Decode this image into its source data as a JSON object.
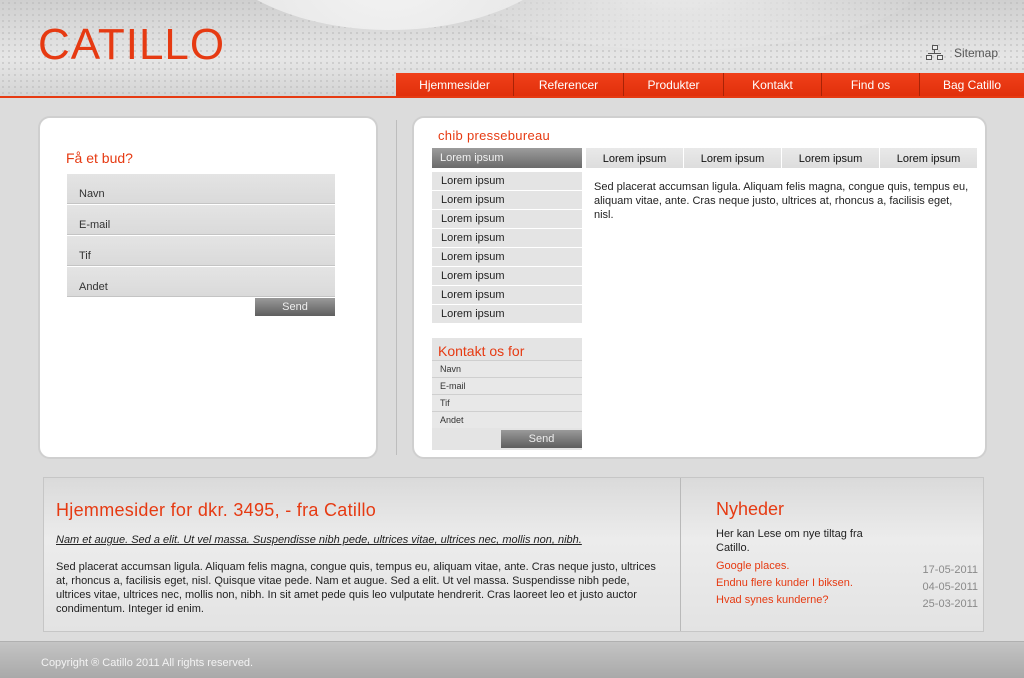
{
  "brand": {
    "logo_text": "CATILLO",
    "accent_color": "#e63a12"
  },
  "header": {
    "sitemap_label": "Sitemap",
    "sitemap_icon": "sitemap-icon",
    "nav": [
      {
        "label": "Hjemmesider"
      },
      {
        "label": "Referencer"
      },
      {
        "label": "Produkter"
      },
      {
        "label": "Kontakt"
      },
      {
        "label": "Find os"
      },
      {
        "label": "Bag Catillo"
      }
    ]
  },
  "quote_form": {
    "title": "Få et bud?",
    "fields": [
      "Navn",
      "E-mail",
      "Tif",
      "Andet"
    ],
    "send_label": "Send"
  },
  "press": {
    "title": "chib pressebureau",
    "active_item": "Lorem ipsum",
    "items": [
      "Lorem ipsum",
      "Lorem ipsum",
      "Lorem ipsum",
      "Lorem ipsum",
      "Lorem ipsum",
      "Lorem ipsum",
      "Lorem ipsum",
      "Lorem ipsum"
    ],
    "tabs": [
      "Lorem ipsum",
      "Lorem ipsum",
      "Lorem ipsum",
      "Lorem ipsum"
    ],
    "tab_text": "Sed placerat accumsan ligula. Aliquam felis magna, congue quis, tempus eu, aliquam vitae, ante. Cras neque justo, ultrices at, rhoncus a, facilisis eget, nisl."
  },
  "contact_form": {
    "title": "Kontakt os for",
    "fields": [
      "Navn",
      "E-mail",
      "Tif",
      "Andet"
    ],
    "send_label": "Send"
  },
  "promo": {
    "title": "Hjemmesider for dkr. 3495, - fra Catillo",
    "lead": "Nam et augue. Sed a elit. Ut vel massa. Suspendisse nibh pede, ultrices vitae, ultrices nec, mollis non, nibh.",
    "body": "Sed placerat accumsan ligula. Aliquam felis magna, congue quis, tempus eu, aliquam vitae, ante. Cras neque justo, ultrices at, rhoncus a, facilisis eget, nisl. Quisque vitae pede. Nam et augue. Sed a elit. Ut vel massa. Suspendisse nibh pede, ultrices vitae, ultrices nec, mollis non, nibh. In sit amet pede quis leo vulputate hendrerit. Cras laoreet leo et justo auctor condimentum. Integer id enim."
  },
  "news": {
    "title": "Nyheder",
    "intro": "Her kan Lese om nye tiltag fra Catillo.",
    "items": [
      {
        "title": "Google places.",
        "date": "17-05-2011"
      },
      {
        "title": "Endnu flere kunder I biksen.",
        "date": "04-05-2011"
      },
      {
        "title": "Hvad synes kunderne?",
        "date": "25-03-2011"
      }
    ]
  },
  "footer": {
    "copyright": "Copyright ® Catillo 2011 All rights reserved."
  }
}
